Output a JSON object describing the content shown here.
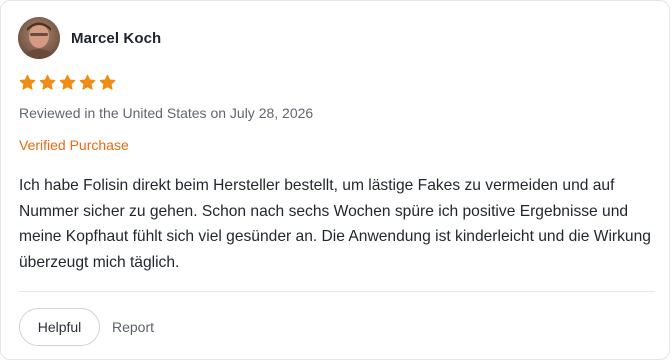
{
  "review": {
    "reviewer_name": "Marcel Koch",
    "rating": 5,
    "max_rating": 5,
    "review_meta": "Reviewed in the United States on July 28, 2026",
    "verified_label": "Verified Purchase",
    "text": "Ich habe Folisin direkt beim Hersteller bestellt, um lästige Fakes zu vermeiden und auf Nummer sicher zu gehen. Schon nach sechs Wochen spüre ich positive Ergebnisse und meine Kopfhaut fühlt sich viel gesünder an. Die Anwendung ist kinderleicht und die Wirkung überzeugt mich täglich."
  },
  "actions": {
    "helpful_label": "Helpful",
    "report_label": "Report"
  },
  "colors": {
    "star": "#f28c14",
    "verified": "#e86a12",
    "border": "#e3e5e8"
  }
}
